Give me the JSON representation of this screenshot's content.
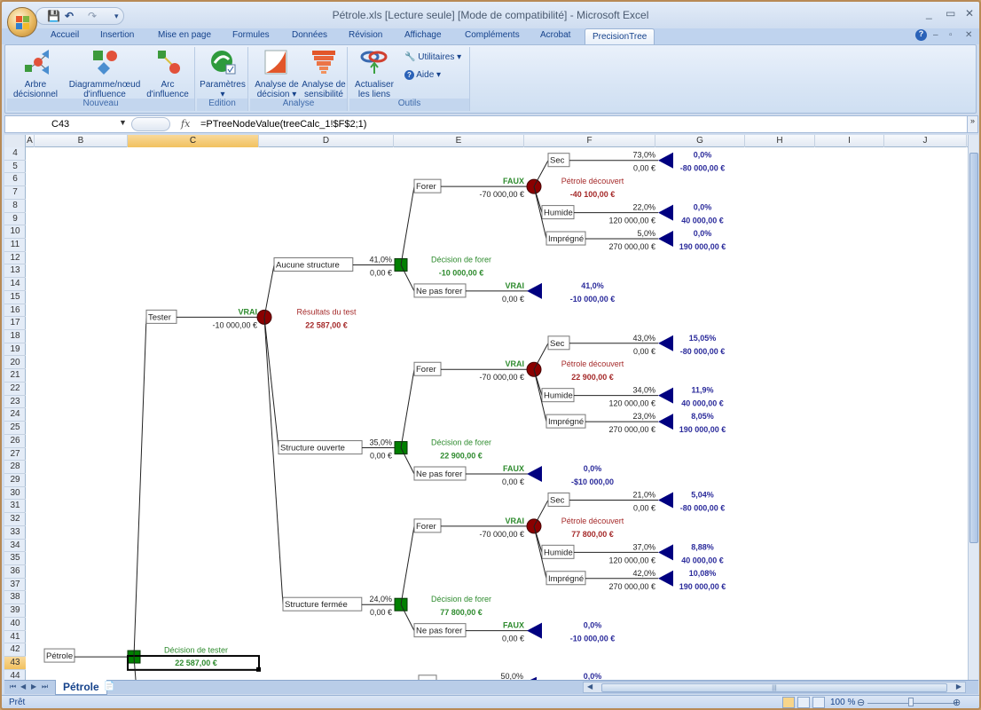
{
  "window": {
    "title": "Pétrole.xls  [Lecture seule]  [Mode de compatibilité] - Microsoft Excel",
    "controls": [
      "_",
      "▭",
      "✕"
    ]
  },
  "qat": {
    "save": "💾",
    "undo": "↶",
    "redo": "↷",
    "customize": "▾"
  },
  "tabs": [
    {
      "label": "Accueil"
    },
    {
      "label": "Insertion"
    },
    {
      "label": "Mise en page"
    },
    {
      "label": "Formules"
    },
    {
      "label": "Données"
    },
    {
      "label": "Révision"
    },
    {
      "label": "Affichage"
    },
    {
      "label": "Compléments"
    },
    {
      "label": "Acrobat"
    },
    {
      "label": "PrecisionTree",
      "active": true
    }
  ],
  "ribbon": {
    "groups": [
      {
        "label": "Nouveau",
        "buttons": [
          {
            "label1": "Arbre",
            "label2": "décisionnel",
            "icon": "decision-tree-icon"
          },
          {
            "label1": "Diagramme/nœud",
            "label2": "d'influence",
            "icon": "influence-diagram-icon"
          },
          {
            "label1": "Arc",
            "label2": "d'influence",
            "icon": "influence-arc-icon"
          }
        ]
      },
      {
        "label": "Edition",
        "buttons": [
          {
            "label1": "Paramètres",
            "label2": "▾",
            "icon": "settings-icon"
          }
        ]
      },
      {
        "label": "Analyse",
        "buttons": [
          {
            "label1": "Analyse de",
            "label2": "décision ▾",
            "icon": "decision-analysis-icon"
          },
          {
            "label1": "Analyse de",
            "label2": "sensibilité",
            "icon": "sensitivity-analysis-icon"
          }
        ]
      },
      {
        "label": "Outils",
        "buttons": [
          {
            "label1": "Actualiser",
            "label2": "les liens",
            "icon": "refresh-links-icon"
          }
        ],
        "small": [
          {
            "label": "Utilitaires ▾",
            "icon": "wrench-icon"
          },
          {
            "label": "Aide ▾",
            "icon": "help-icon"
          }
        ]
      }
    ]
  },
  "formula_bar": {
    "name_box": "C43",
    "fx": "fx",
    "formula": "=PTreeNodeValue(treeCalc_1!$F$2;1)"
  },
  "columns": [
    "A",
    "B",
    "C",
    "D",
    "E",
    "F",
    "G",
    "H",
    "I",
    "J"
  ],
  "selected_column": "C",
  "rows": [
    4,
    5,
    6,
    7,
    8,
    9,
    10,
    11,
    12,
    13,
    14,
    15,
    16,
    17,
    18,
    19,
    20,
    21,
    22,
    23,
    24,
    25,
    26,
    27,
    28,
    29,
    30,
    31,
    32,
    33,
    34,
    35,
    36,
    37,
    38,
    39,
    40,
    41,
    42,
    43,
    44
  ],
  "selected_row": 43,
  "colors": {
    "decision_node": "#008000",
    "chance_node": "#8b0000",
    "terminal_node": "#000080",
    "decision_text": "#2e8b2e",
    "chance_text": "#a52a2a",
    "terminal_text": "#2b2b9b"
  },
  "tree": {
    "root": {
      "label": "Pétrole",
      "node_title": "Décision de tester",
      "node_value": "22 587,00 €"
    },
    "tester": {
      "label": "Tester",
      "flag": "VRAI",
      "value": "-10 000,00 €",
      "chance_title": "Résultats du test",
      "chance_value": "22 587,00 €"
    },
    "structures": [
      {
        "label": "Aucune structure",
        "prob": "41,0%",
        "value": "0,00 €",
        "decision_title": "Décision de forer",
        "decision_value": "-10 000,00 €",
        "forer": {
          "label": "Forer",
          "flag": "FAUX",
          "value": "-70 000,00 €",
          "chance_title": "Pétrole découvert",
          "chance_value": "-40 100,00 €",
          "outcomes": [
            {
              "label": "Sec",
              "prob": "73,0%",
              "value": "0,00 €",
              "res_prob": "0,0%",
              "res_value": "-80 000,00 €"
            },
            {
              "label": "Humide",
              "prob": "22,0%",
              "value": "120 000,00 €",
              "res_prob": "0,0%",
              "res_value": "40 000,00 €"
            },
            {
              "label": "Imprégné",
              "prob": "5,0%",
              "value": "270 000,00 €",
              "res_prob": "0,0%",
              "res_value": "190 000,00 €"
            }
          ]
        },
        "ne_pas_forer": {
          "label": "Ne pas forer",
          "flag": "VRAI",
          "value": "0,00 €",
          "res_prob": "41,0%",
          "res_value": "-10 000,00 €"
        }
      },
      {
        "label": "Structure ouverte",
        "prob": "35,0%",
        "value": "0,00 €",
        "decision_title": "Décision de forer",
        "decision_value": "22 900,00 €",
        "forer": {
          "label": "Forer",
          "flag": "VRAI",
          "value": "-70 000,00 €",
          "chance_title": "Pétrole découvert",
          "chance_value": "22 900,00 €",
          "outcomes": [
            {
              "label": "Sec",
              "prob": "43,0%",
              "value": "0,00 €",
              "res_prob": "15,05%",
              "res_value": "-80 000,00 €"
            },
            {
              "label": "Humide",
              "prob": "34,0%",
              "value": "120 000,00 €",
              "res_prob": "11,9%",
              "res_value": "40 000,00 €"
            },
            {
              "label": "Imprégné",
              "prob": "23,0%",
              "value": "270 000,00 €",
              "res_prob": "8,05%",
              "res_value": "190 000,00 €"
            }
          ]
        },
        "ne_pas_forer": {
          "label": "Ne pas forer",
          "flag": "FAUX",
          "value": "0,00 €",
          "res_prob": "0,0%",
          "res_value": "-$10 000,00"
        }
      },
      {
        "label": "Structure fermée",
        "prob": "24,0%",
        "value": "0,00 €",
        "decision_title": "Décision de forer",
        "decision_value": "77 800,00 €",
        "forer": {
          "label": "Forer",
          "flag": "VRAI",
          "value": "-70 000,00 €",
          "chance_title": "Pétrole découvert",
          "chance_value": "77 800,00 €",
          "outcomes": [
            {
              "label": "Sec",
              "prob": "21,0%",
              "value": "0,00 €",
              "res_prob": "5,04%",
              "res_value": "-80 000,00 €"
            },
            {
              "label": "Humide",
              "prob": "37,0%",
              "value": "120 000,00 €",
              "res_prob": "8,88%",
              "res_value": "40 000,00 €"
            },
            {
              "label": "Imprégné",
              "prob": "42,0%",
              "value": "270 000,00 €",
              "res_prob": "10,08%",
              "res_value": "190 000,00 €"
            }
          ]
        },
        "ne_pas_forer": {
          "label": "Ne pas forer",
          "flag": "FAUX",
          "value": "0,00 €",
          "res_prob": "0,0%",
          "res_value": "-10 000,00 €"
        }
      }
    ],
    "partial": {
      "prob": "50,0%",
      "res_prob": "0,0%"
    }
  },
  "sheet_tabs": [
    {
      "label": "Pétrole",
      "active": true
    }
  ],
  "status": {
    "text": "Prêt",
    "zoom": "100 %"
  }
}
